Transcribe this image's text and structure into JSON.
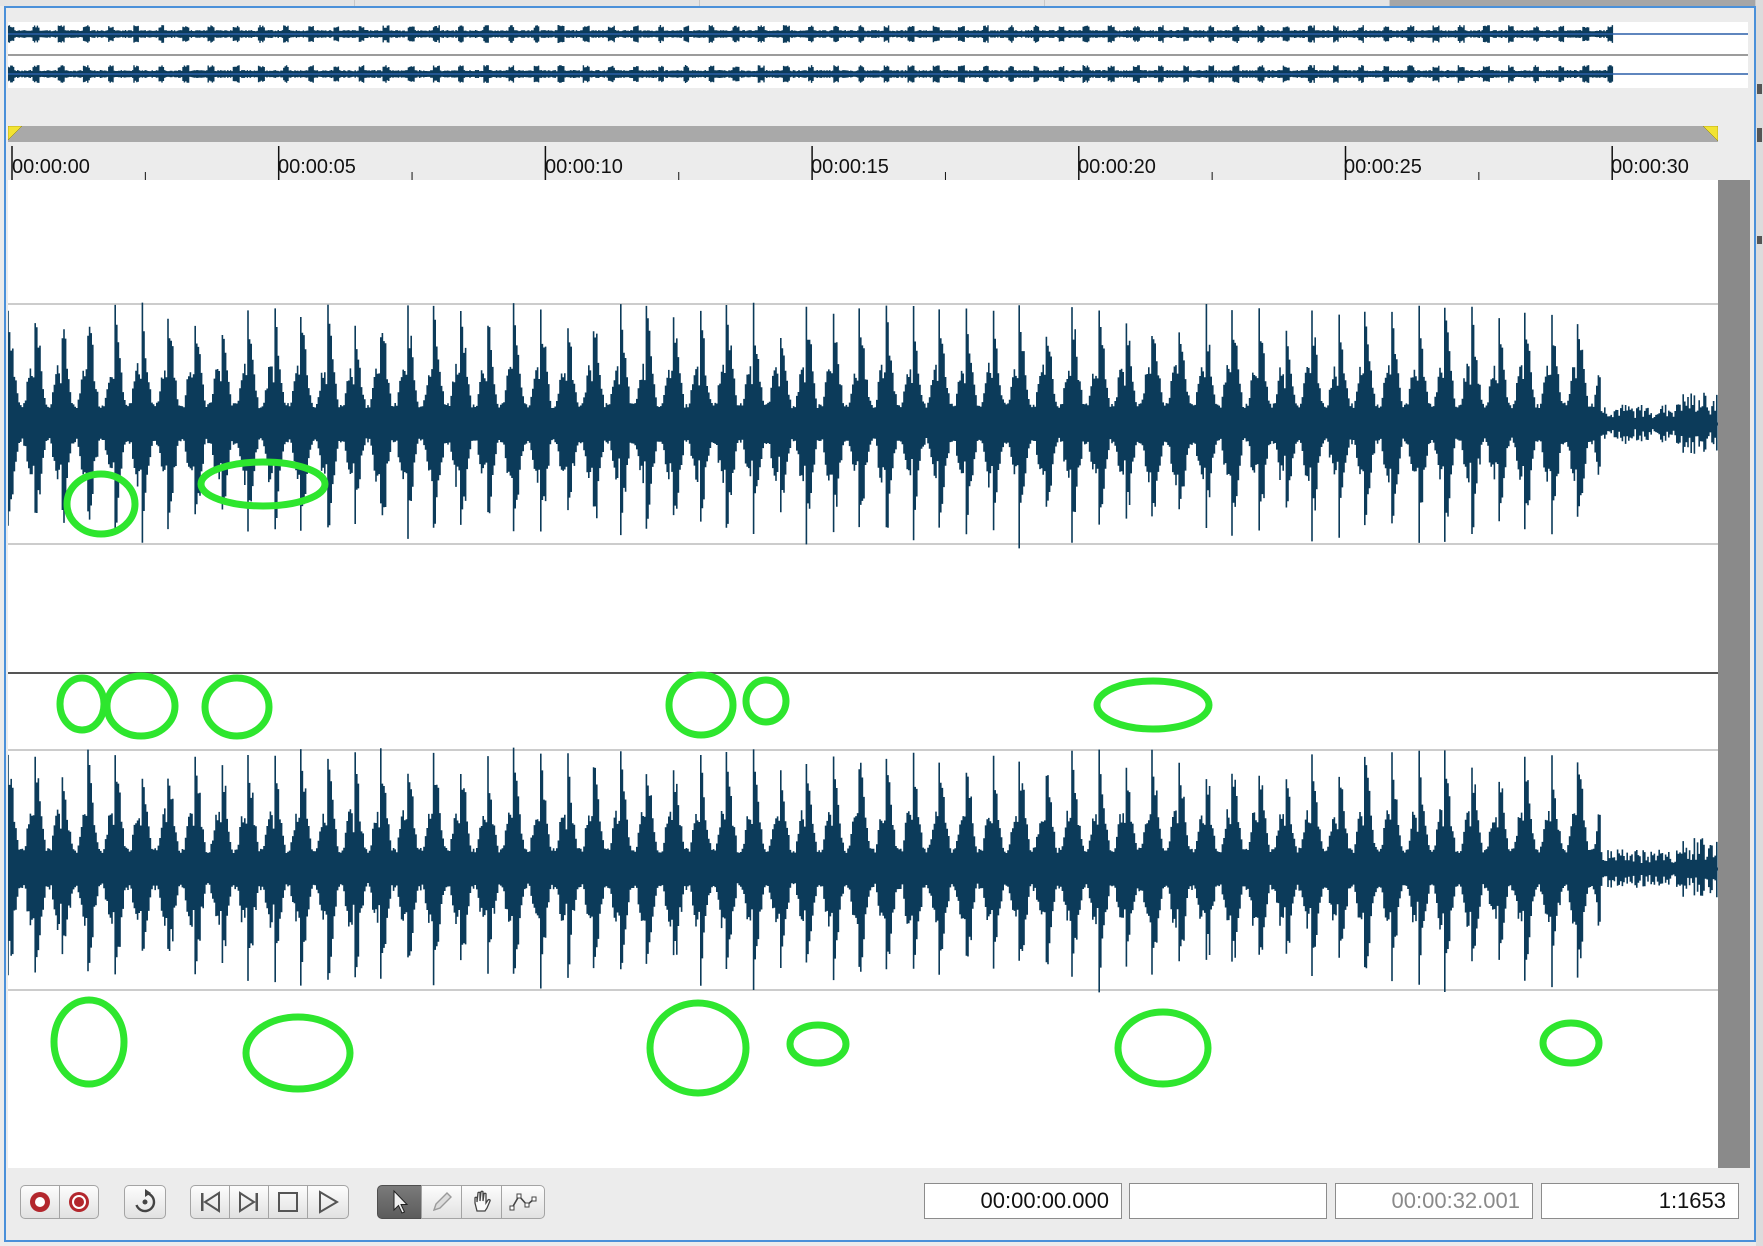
{
  "timeline": {
    "ticks": [
      {
        "label": "00:00:00"
      },
      {
        "label": "00:00:05"
      },
      {
        "label": "00:00:10"
      },
      {
        "label": "00:00:15"
      },
      {
        "label": "00:00:20"
      },
      {
        "label": "00:00:25"
      },
      {
        "label": "00:00:30"
      }
    ]
  },
  "colors": {
    "waveform": "#0c3b5a",
    "annotation": "#2ee62e",
    "selection_border": "#4a90d9",
    "marker": "#f2e332"
  },
  "toolbar": {
    "buttons": [
      {
        "name": "record-icon"
      },
      {
        "name": "record-armed-icon"
      },
      {
        "name": "loop-icon"
      },
      {
        "name": "go-to-start-icon"
      },
      {
        "name": "go-to-end-icon"
      },
      {
        "name": "stop-icon"
      },
      {
        "name": "play-icon"
      },
      {
        "name": "select-tool-icon"
      },
      {
        "name": "pencil-tool-icon"
      },
      {
        "name": "hand-tool-icon"
      },
      {
        "name": "envelope-tool-icon"
      }
    ],
    "fields": {
      "cursor_position": "00:00:00.000",
      "selection": "",
      "length": "00:00:32.001",
      "zoom": "1:1653"
    }
  }
}
